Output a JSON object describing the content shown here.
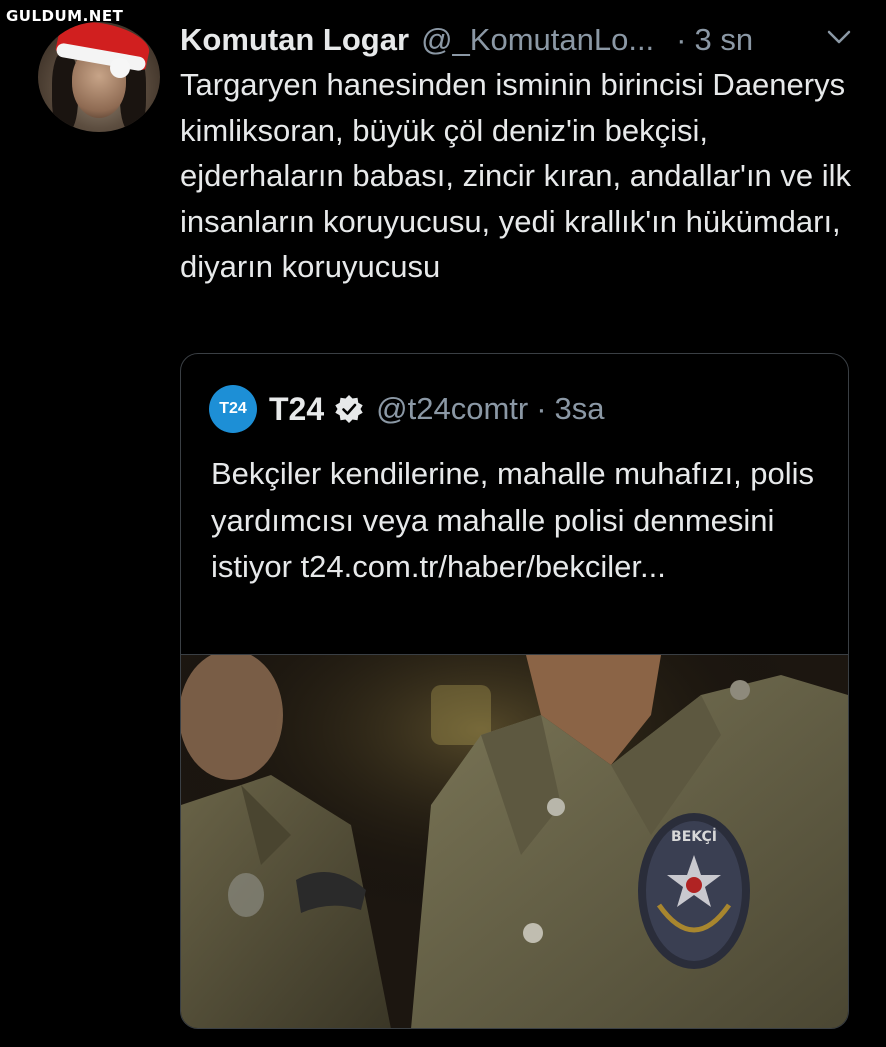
{
  "watermark": "GULDUM.NET",
  "tweet": {
    "author_name": "Komutan Logar",
    "author_handle": "@_KomutanLo...",
    "separator": "·",
    "time": "3 sn",
    "text": "Targaryen hanesinden isminin birincisi Daenerys kimliksoran, büyük çöl deniz'in bekçisi, ejderhaların babası, zincir kıran, andallar'ın ve ilk insanların koruyucusu, yedi krallık'ın hükümdarı, diyarın koruyucusu"
  },
  "quote": {
    "logo_text": "T24",
    "author_name": "T24",
    "author_handle": "@t24comtr",
    "separator": "·",
    "time": "3sa",
    "text": "Bekçiler kendilerine, mahalle muhafızı, polis yardımcısı veya mahalle polisi denmesini istiyor t24.com.tr/haber/bekciler...",
    "image_badge_text": "BEKÇİ"
  },
  "colors": {
    "background": "#000000",
    "secondary_text": "#8b98a5",
    "logo_blue": "#1d8fd6",
    "border": "#3a3f44"
  },
  "icons": {
    "menu": "chevron-down-icon",
    "verified": "verified-badge-icon"
  }
}
